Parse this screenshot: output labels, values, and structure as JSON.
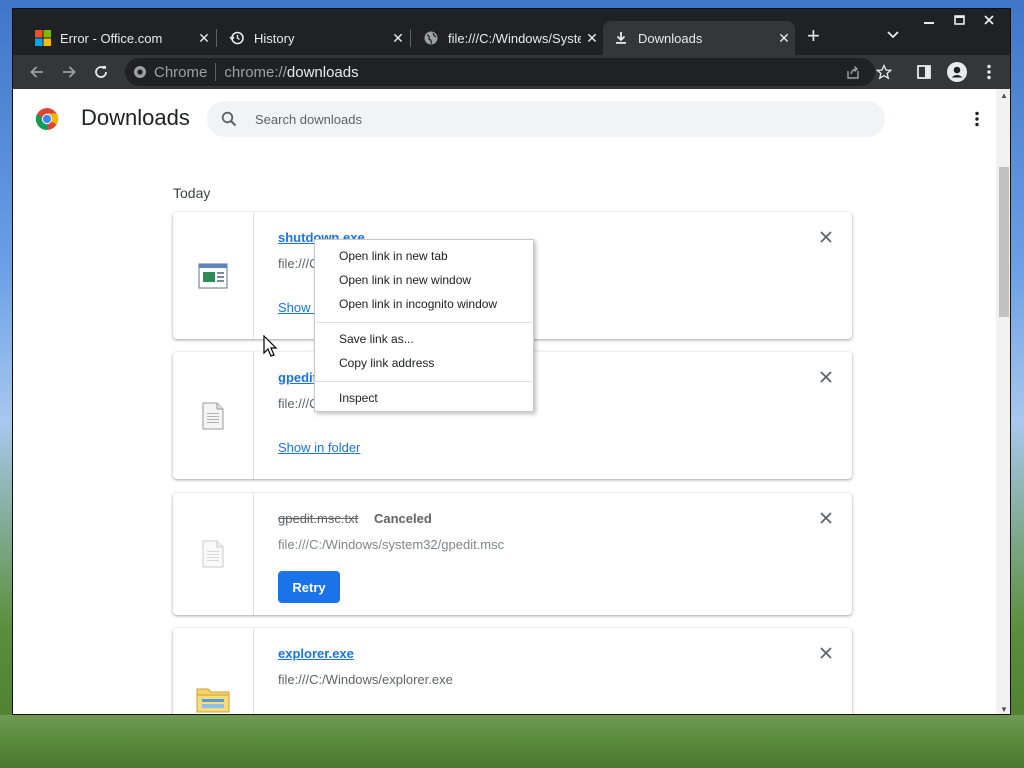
{
  "tabs": [
    {
      "title": "Error - Office.com",
      "icon": "microsoft-logo-icon",
      "active": false
    },
    {
      "title": "History",
      "icon": "history-icon",
      "active": false
    },
    {
      "title": "file:///C:/Windows/Syste",
      "icon": "globe-icon",
      "active": false
    },
    {
      "title": "Downloads",
      "icon": "download-icon",
      "active": true
    }
  ],
  "toolbar": {
    "chip_label": "Chrome",
    "url_scheme": "chrome://",
    "url_host": "downloads"
  },
  "page": {
    "title": "Downloads",
    "search_placeholder": "Search downloads",
    "section_label": "Today"
  },
  "downloads": [
    {
      "file_name": "shutdown.exe",
      "url": "file:///C",
      "action": "Show i",
      "icon": "executable-file-icon"
    },
    {
      "file_name": "gpedit",
      "url": "file:///C",
      "action": "Show in folder",
      "icon": "document-file-icon"
    },
    {
      "file_name": "gpedit.msc.txt",
      "status": "Canceled",
      "url": "file:///C:/Windows/system32/gpedit.msc",
      "action": "Retry",
      "icon": "document-file-icon"
    },
    {
      "file_name": "explorer.exe",
      "url": "file:///C:/Windows/explorer.exe",
      "icon": "folder-app-icon"
    }
  ],
  "context_menu": {
    "items": [
      "Open link in new tab",
      "Open link in new window",
      "Open link in incognito window",
      "Save link as...",
      "Copy link address",
      "Inspect"
    ]
  },
  "colors": {
    "accent": "#1a73e8",
    "tab_strip": "#202124",
    "toolbar": "#35363a"
  }
}
